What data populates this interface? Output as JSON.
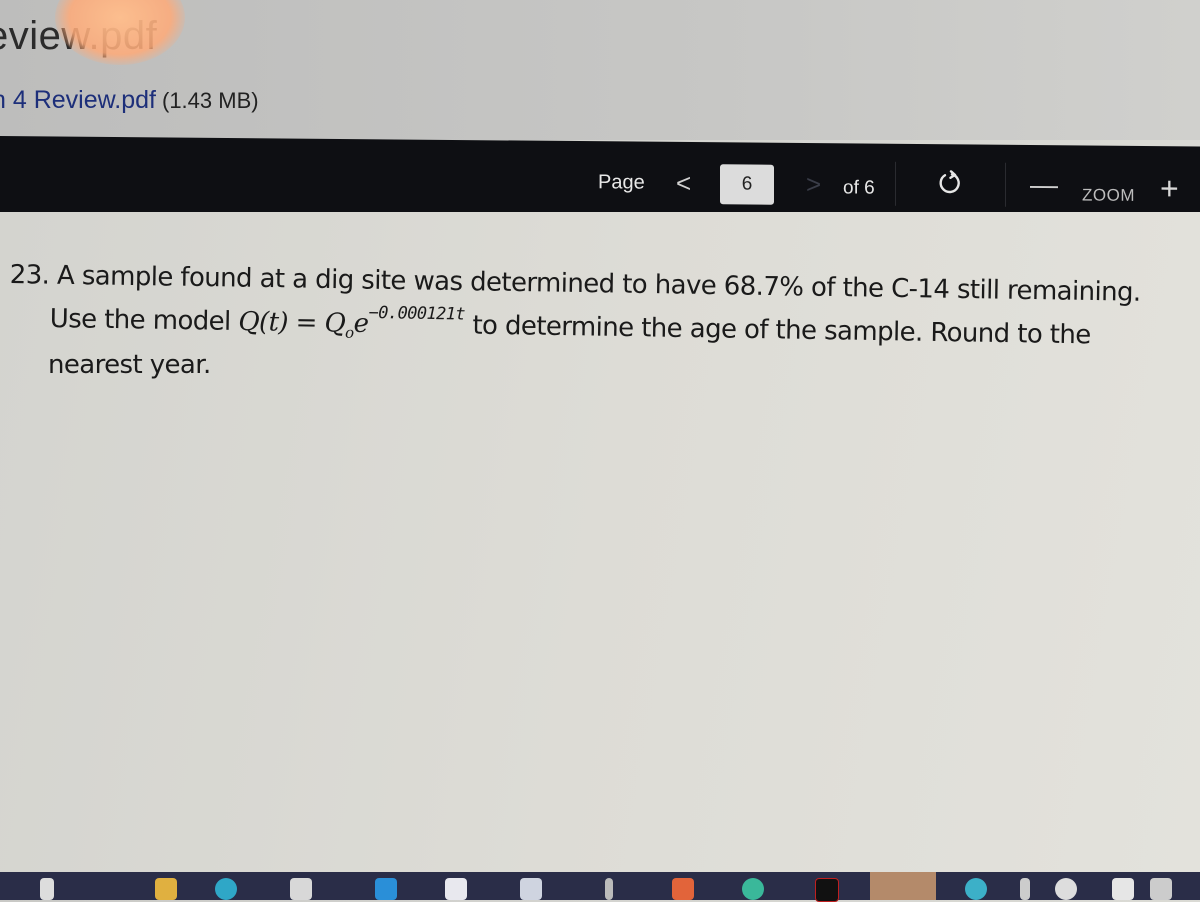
{
  "header": {
    "file_title": "eview.pdf",
    "file_link": "n 4 Review.pdf",
    "file_size": "(1.43 MB)"
  },
  "toolbar": {
    "page_label": "Page",
    "prev_icon": "chevron-left-icon",
    "prev_glyph": "<",
    "current_page": "6",
    "next_icon": "chevron-right-icon",
    "next_glyph": ">",
    "of_label": "of 6",
    "refresh_icon": "refresh-icon",
    "zoom_out_glyph": "—",
    "zoom_label": "ZOOM",
    "zoom_in_glyph": "+"
  },
  "document": {
    "question_number": "23.",
    "line1_text": "A sample found at a dig site was determined to have 68.7% of the C-14 still remaining.",
    "line2_prefix": "Use the model ",
    "formula_lhs": "Q(t) = Q",
    "formula_sub": "o",
    "formula_base": "e",
    "formula_exponent": "−0.000121t",
    "line2_suffix": " to determine the age of the sample.  Round to the",
    "line3_text": "nearest year."
  },
  "taskbar": {
    "icons": [
      "app-icon-1",
      "file-explorer-icon",
      "edge-icon",
      "store-icon",
      "drive-icon",
      "word-icon",
      "dropbox-icon",
      "pen-icon",
      "office-icon",
      "chrome-icon",
      "netflix-icon",
      "app-icon-2",
      "app-icon-3",
      "tray-icon-1",
      "tray-icon-2",
      "tray-icon-3",
      "tray-icon-4"
    ],
    "colors": {
      "bar": "#2a2d48",
      "highlight": "#b48a6a"
    }
  }
}
